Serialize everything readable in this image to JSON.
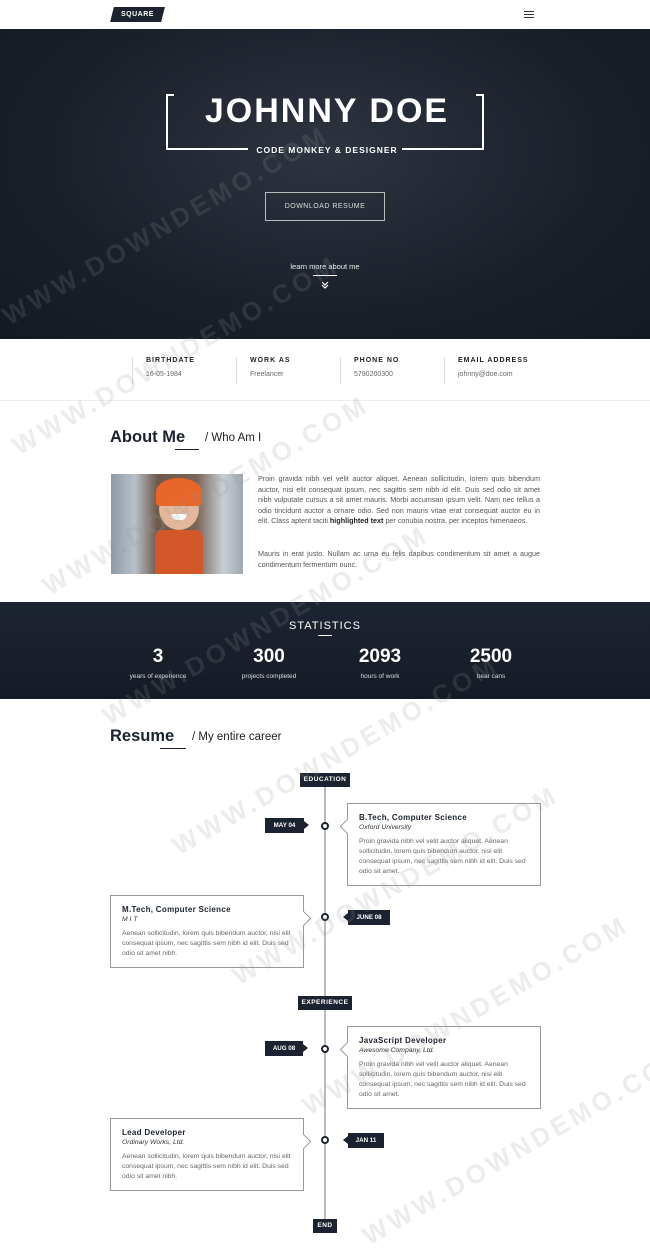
{
  "nav": {
    "logo": "SQUARE",
    "menu_icon": "hamburger-icon"
  },
  "hero": {
    "name": "JOHNNY DOE",
    "subtitle": "CODE MONKEY & DESIGNER",
    "button": "DOWNLOAD RESUME",
    "learn_more": "learn more about me",
    "chevron_icon": "double-chevron-down-icon"
  },
  "info": [
    {
      "label": "BIRTHDATE",
      "value": "16-05-1984"
    },
    {
      "label": "WORK AS",
      "value": "Freelancer"
    },
    {
      "label": "PHONE NO",
      "value": "5790200300"
    },
    {
      "label": "EMAIL ADDRESS",
      "value": "johnny@doe.com"
    }
  ],
  "about": {
    "title": "About Me",
    "subtitle": "/ Who Am I",
    "p1_a": "Proin gravida nibh vel velit auctor aliquet. Aenean sollicitudin, lorem quis bibendum auctor, nisi elit consequat ipsum, nec sagittis sem nibh id elit. Duis sed odio sit amet nibh vulputate cursus a sit amet mauris. Morbi accumsan ipsum velit. Nam nec tellus a odio tincidunt auctor a ornare odio. Sed non mauris vitae erat consequat auctor eu in elit. Class aptent taciti",
    "p1_bold": "highlighted text",
    "p1_b": "per conubia nostra, per inceptos himenaeos.",
    "p2": "Mauris in erat justo. Nullam ac urna eu felis dapibus condimentum sit amet a augue condimentum fermentum nunc."
  },
  "stats": {
    "title": "STATISTICS",
    "items": [
      {
        "number": "3",
        "label": "years of experience"
      },
      {
        "number": "300",
        "label": "projects completed"
      },
      {
        "number": "2093",
        "label": "hours of work"
      },
      {
        "number": "2500",
        "label": "bear cans"
      }
    ]
  },
  "resume": {
    "title": "Resume",
    "subtitle": "/ My entire career",
    "tag_education": "EDUCATION",
    "tag_experience": "EXPERIENCE",
    "tag_end": "END",
    "entries": [
      {
        "date": "MAY 04",
        "title": "B.Tech, Computer Science",
        "sub": "Oxford University",
        "text": "Proin gravida nibh vel velit auctor aliquet. Aenean sollicitudin, lorem quis bibendum auctor, nisi elit consequat ipsum, nec sagittis sem nibh id elit. Duis sed odio sit amet."
      },
      {
        "date": "JUNE 08",
        "title": "M.Tech, Computer Science",
        "sub": "M I T",
        "text": "Aenean sollicitudin, lorem quis bibendum auctor, nisi elit consequat ipsum, nec sagittis sem nibh id elit. Duis sed odio sit amet nibh."
      },
      {
        "date": "AUG 08",
        "title": "JavaScript Developer",
        "sub": "Awesome Company, Ltd.",
        "text": "Proin gravida nibh vel velit auctor aliquet. Aenean sollicitudin, lorem quis bibendum auctor, nisi elit consequat ipsum, nec sagittis sem nibh id elit. Duis sed odio sit amet."
      },
      {
        "date": "JAN 11",
        "title": "Lead Developer",
        "sub": "Ordinary Works, Ltd.",
        "text": "Aenean sollicitudin, lorem quis bibendum auctor, nisi elit consequat ipsum, nec sagittis sem nibh id elit. Duis sed odio sit amet nibh."
      }
    ]
  },
  "watermark": "WWW.DOWNDEMO.COM"
}
